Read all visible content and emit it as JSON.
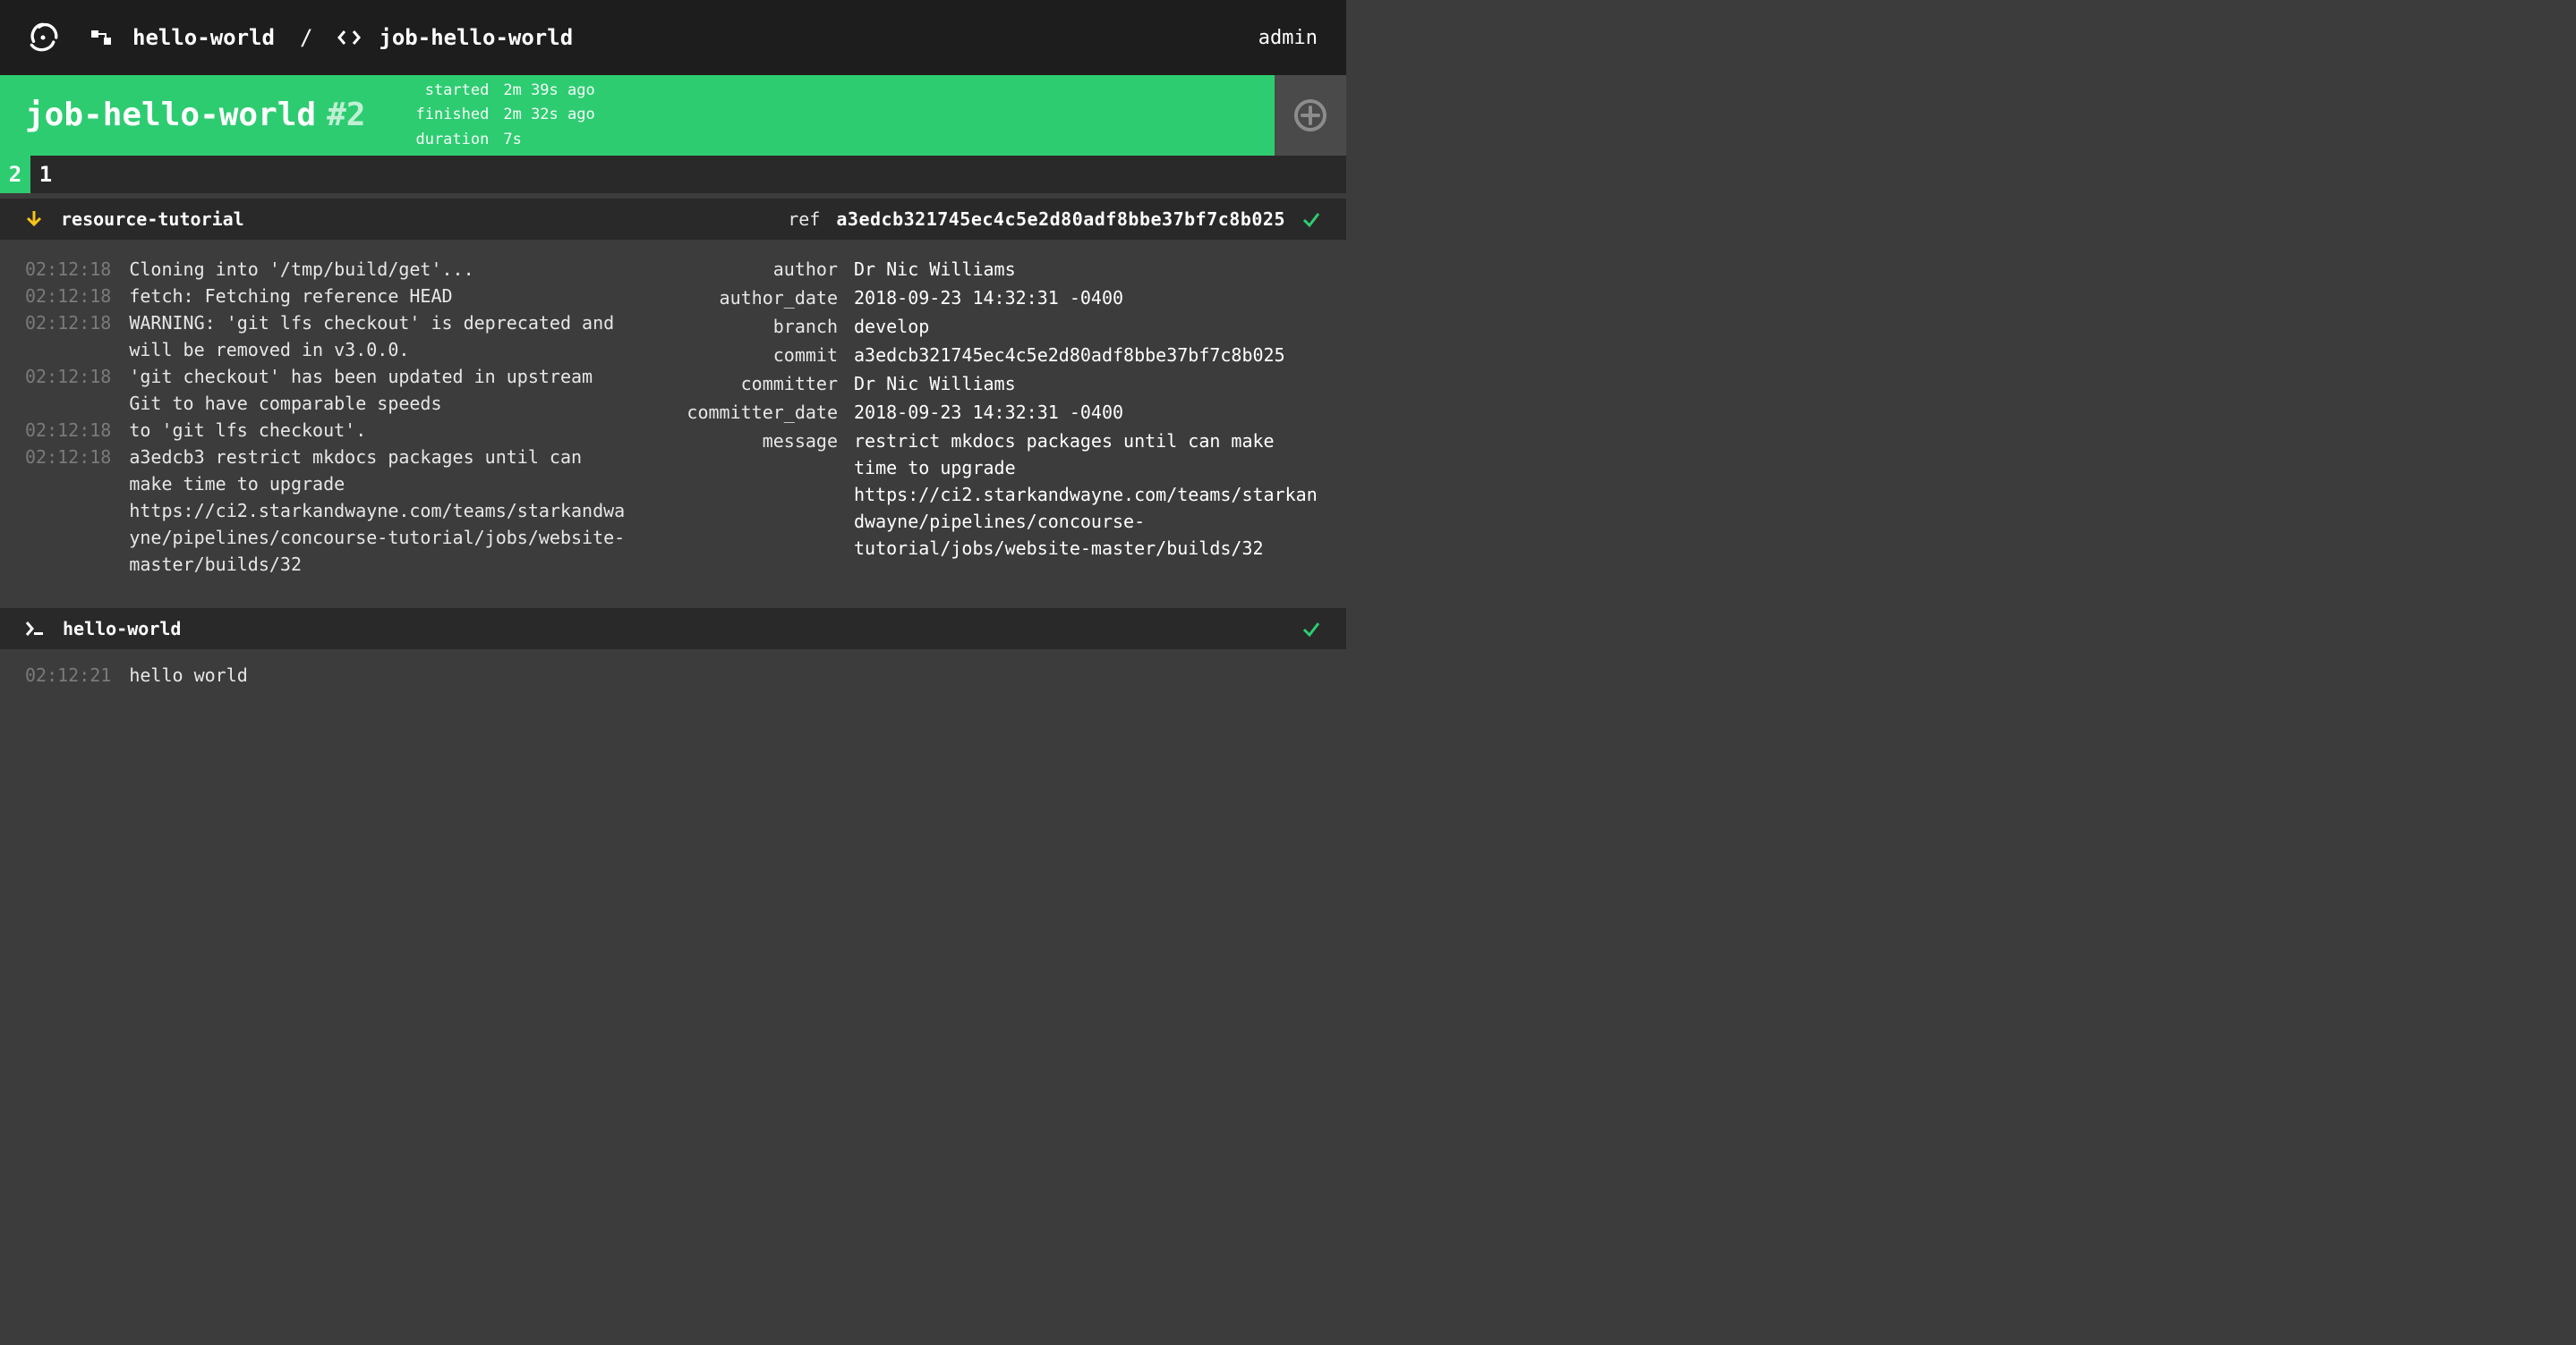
{
  "topbar": {
    "pipeline": "hello-world",
    "job": "job-hello-world",
    "user": "admin"
  },
  "build": {
    "job_name": "job-hello-world",
    "number": "#2",
    "timing": {
      "started_label": "started",
      "started_value": "2m 39s ago",
      "finished_label": "finished",
      "finished_value": "2m 32s ago",
      "duration_label": "duration",
      "duration_value": "7s"
    },
    "tabs": [
      "2",
      "1"
    ],
    "active_tab": "2"
  },
  "get_step": {
    "name": "resource-tutorial",
    "ref_label": "ref",
    "ref_value": "a3edcb321745ec4c5e2d80adf8bbe37bf7c8b025",
    "log": [
      {
        "ts": "02:12:18",
        "msg": "Cloning into '/tmp/build/get'..."
      },
      {
        "ts": "02:12:18",
        "msg": "fetch: Fetching reference HEAD"
      },
      {
        "ts": "02:12:18",
        "msg": "WARNING: 'git lfs checkout' is deprecated and will be removed in v3.0.0."
      },
      {
        "ts": "02:12:18",
        "msg": "'git checkout' has been updated in upstream Git to have comparable speeds"
      },
      {
        "ts": "02:12:18",
        "msg": "to 'git lfs checkout'."
      },
      {
        "ts": "02:12:18",
        "msg": "a3edcb3 restrict mkdocs packages until can make time to upgrade https://ci2.starkandwayne.com/teams/starkandwayne/pipelines/concourse-tutorial/jobs/website-master/builds/32"
      }
    ],
    "metadata": [
      {
        "key": "author",
        "val": "Dr Nic Williams"
      },
      {
        "key": "author_date",
        "val": "2018-09-23 14:32:31 -0400"
      },
      {
        "key": "branch",
        "val": "develop"
      },
      {
        "key": "commit",
        "val": "a3edcb321745ec4c5e2d80adf8bbe37bf7c8b025"
      },
      {
        "key": "committer",
        "val": "Dr Nic Williams"
      },
      {
        "key": "committer_date",
        "val": "2018-09-23 14:32:31 -0400"
      },
      {
        "key": "message",
        "val": "restrict mkdocs packages until can make time to upgrade https://ci2.starkandwayne.com/teams/starkandwayne/pipelines/concourse-tutorial/jobs/website-master/builds/32"
      }
    ]
  },
  "task_step": {
    "name": "hello-world",
    "log": [
      {
        "ts": "02:12:21",
        "msg": "hello world"
      }
    ]
  }
}
